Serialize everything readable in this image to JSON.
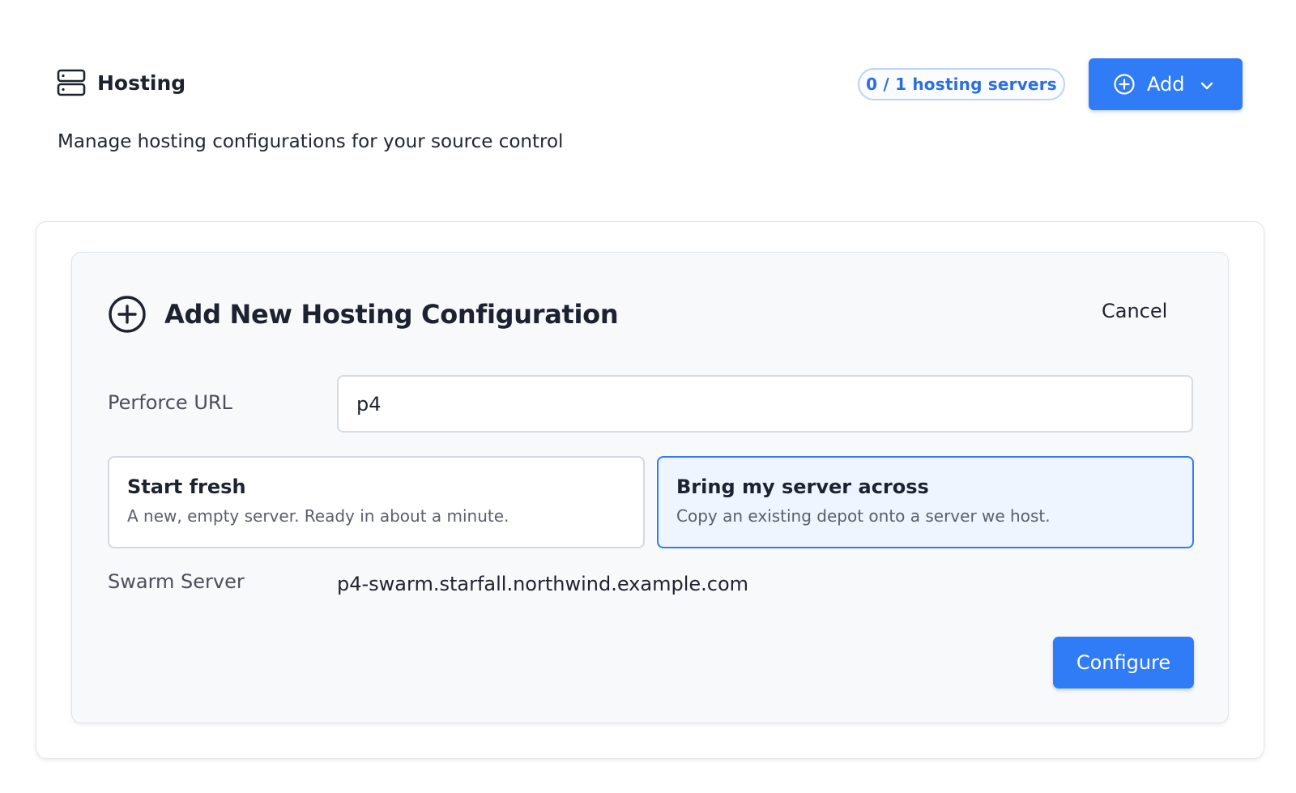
{
  "header": {
    "title": "Hosting",
    "icon": "server-icon",
    "subtitle": "Manage hosting configurations for your source control",
    "count_badge": "0 / 1 hosting servers",
    "add_button": {
      "label": "Add",
      "icon": "plus-circle-icon",
      "dropdown_icon": "chevron-down-icon"
    }
  },
  "form": {
    "title": "Add New Hosting Configuration",
    "title_icon": "plus-circle-icon",
    "cancel_label": "Cancel",
    "perforce_url": {
      "label": "Perforce URL",
      "value": "p4"
    },
    "options": [
      {
        "title": "Start fresh",
        "description": "A new, empty server. Ready in about a minute.",
        "selected": false
      },
      {
        "title": "Bring my server across",
        "description": "Copy an existing depot onto a server we host.",
        "selected": true
      }
    ],
    "swarm_server": {
      "label": "Swarm Server",
      "value": "p4-swarm.starfall.northwind.example.com"
    },
    "configure_label": "Configure"
  },
  "colors": {
    "accent": "#2f7cf6",
    "badge_text": "#2a6fe0",
    "selected_option_bg": "#eef5ff"
  }
}
